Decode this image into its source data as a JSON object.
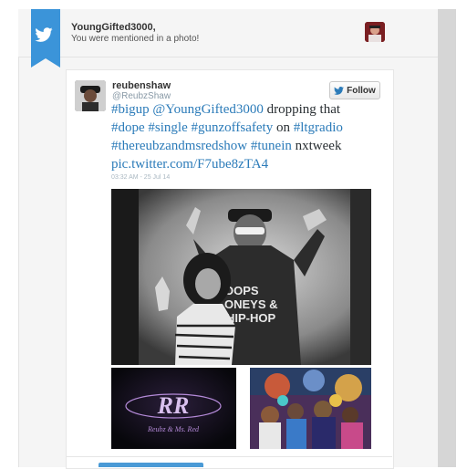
{
  "notification": {
    "username": "YoungGifted3000,",
    "message": "You were mentioned in a photo!"
  },
  "tweet": {
    "display_name": "reubenshaw",
    "handle": "@ReubzShaw",
    "follow_label": "Follow",
    "line1_tag1": "#bigup",
    "line1_mention": "@YoungGifted3000",
    "line1_text": " dropping that",
    "line2_tag1": "#dope",
    "line2_tag2": "#single",
    "line2_tag3": "#gunzoffsafety",
    "line2_text": " on ",
    "line2_tag4": "#ltgradio",
    "line3_tag1": "#thereubzandmsredshow",
    "line3_tag2": "#tunein",
    "line3_text": " nxtweek",
    "link": "pic.twitter.com/F7ube8zTA4",
    "timestamp": "03:32 AM - 25 Jul 14"
  },
  "media": {
    "shirt_text_1": "OOPS",
    "shirt_text_2": "ONEYS &",
    "shirt_text_3": "HIP-HOP",
    "logo_letters": "RR",
    "logo_caption": "Reubz & Ms. Red"
  },
  "colors": {
    "twitter_blue": "#2b7bb9",
    "ribbon_blue": "#3b94d9",
    "logo_purple": "#b48ad8"
  }
}
